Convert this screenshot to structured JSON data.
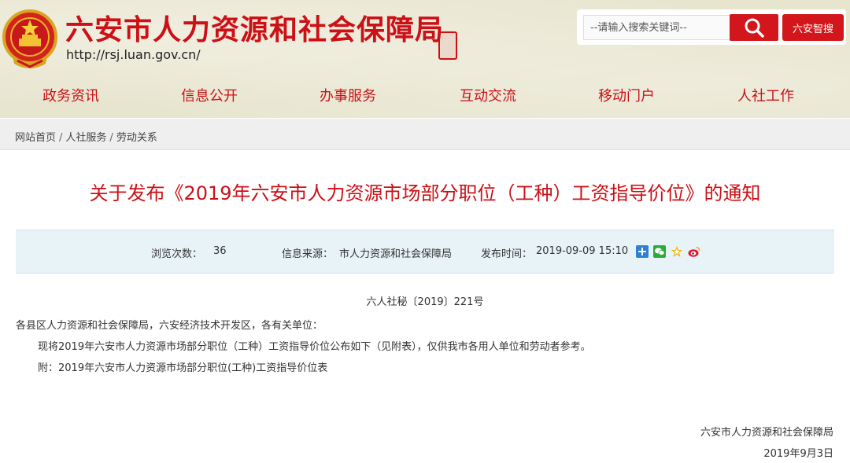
{
  "header": {
    "site_title": "六安市人力资源和社会保障局",
    "site_url": "http://rsj.luan.gov.cn/",
    "search": {
      "placeholder": "--请输入搜索关键词--",
      "button_icon": "search-icon",
      "smart_search_label": "六安智搜"
    },
    "brand_color": "#cc1016"
  },
  "nav": {
    "items": [
      {
        "label": "政务资讯"
      },
      {
        "label": "信息公开"
      },
      {
        "label": "办事服务"
      },
      {
        "label": "互动交流"
      },
      {
        "label": "移动门户"
      },
      {
        "label": "人社工作"
      }
    ]
  },
  "breadcrumb": {
    "items": [
      "网站首页",
      "人社服务",
      "劳动关系"
    ],
    "separator": "/"
  },
  "article": {
    "title": "关于发布《2019年六安市人力资源市场部分职位（工种）工资指导价位》的通知",
    "meta": {
      "views_label": "浏览次数：",
      "views_value": "36",
      "source_label": "信息来源：",
      "source_value": "市人力资源和社会保障局",
      "date_label": "发布时间：",
      "date_value": "2019-09-09 15:10",
      "share_icons": [
        "plus-share-icon",
        "wechat-icon",
        "qzone-icon",
        "weibo-icon"
      ]
    },
    "doc_number": "六人社秘〔2019〕221号",
    "addressee": "各县区人力资源和社会保障局，六安经济技术开发区，各有关单位：",
    "body": "现将2019年六安市人力资源市场部分职位（工种）工资指导价位公布如下（见附表），仅供我市各用人单位和劳动者参考。",
    "attachment": "附：2019年六安市人力资源市场部分职位(工种)工资指导价位表",
    "signature": "六安市人力资源和社会保障局",
    "sign_date": "2019年9月3日"
  }
}
